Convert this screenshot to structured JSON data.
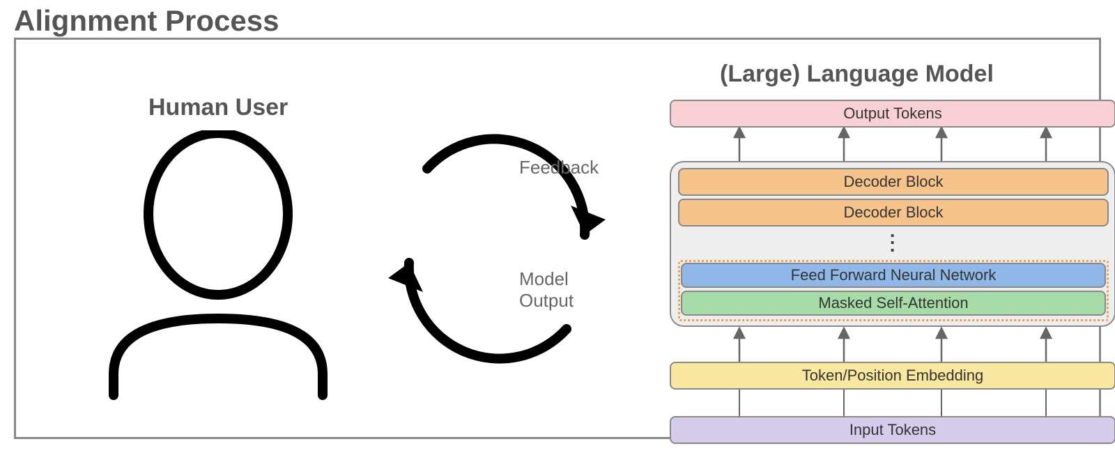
{
  "diagram": {
    "title": "Alignment Process",
    "human_label": "Human User",
    "llm_label": "(Large) Language Model",
    "cycle": {
      "top_label": "Feedback",
      "bottom_label_line1": "Model",
      "bottom_label_line2": "Output"
    },
    "llm_blocks": {
      "output_tokens": "Output Tokens",
      "decoder_block_1": "Decoder Block",
      "decoder_block_2": "Decoder Block",
      "ffn": "Feed Forward Neural Network",
      "msa": "Masked Self-Attention",
      "embedding": "Token/Position Embedding",
      "input_tokens": "Input Tokens"
    }
  },
  "colors": {
    "output": "#f9d0d6",
    "decoder": "#f6c38b",
    "dotted": "#e8a05a",
    "ffn": "#8fb8e8",
    "msa": "#a7dba7",
    "embed": "#f9e79f",
    "input": "#d6ccec",
    "frame": "#888888",
    "text_muted": "#666666"
  }
}
